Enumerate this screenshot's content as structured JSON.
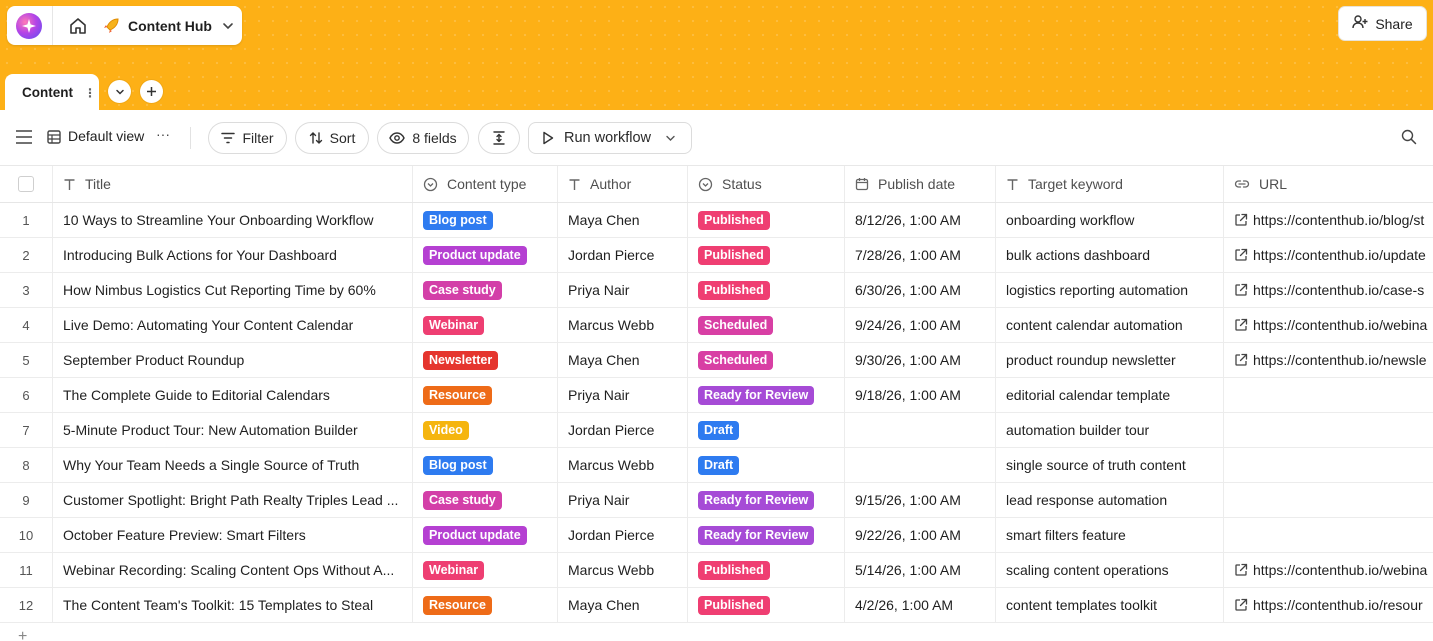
{
  "header": {
    "hub_title": "Content Hub",
    "share_label": "Share"
  },
  "tabs": [
    {
      "label": "Content"
    }
  ],
  "toolbar": {
    "view_label": "Default view",
    "more": "···",
    "filter_label": "Filter",
    "sort_label": "Sort",
    "fields_label": "8 fields",
    "workflow_label": "Run workflow"
  },
  "columns": {
    "title": "Title",
    "content_type": "Content type",
    "author": "Author",
    "status": "Status",
    "publish_date": "Publish date",
    "target_keyword": "Target keyword",
    "url": "URL"
  },
  "colors": {
    "header_band": "#fdb016",
    "type": {
      "Blog post": "#2e7bf0",
      "Product update": "#b540d2",
      "Case study": "#d33fa8",
      "Webinar": "#ee3e72",
      "Newsletter": "#e5352e",
      "Resource": "#ee6b18",
      "Video": "#f5b50f"
    },
    "status": {
      "Published": "#ef3e72",
      "Scheduled": "#d83fa4",
      "Ready for Review": "#a64bd6",
      "Draft": "#2e7bf0"
    }
  },
  "rows": [
    {
      "num": "1",
      "title": "10 Ways to Streamline Your Onboarding Workflow",
      "type": "Blog post",
      "author": "Maya Chen",
      "status": "Published",
      "date": "8/12/26, 1:00 AM",
      "keyword": "onboarding workflow",
      "url": "https://contenthub.io/blog/st"
    },
    {
      "num": "2",
      "title": "Introducing Bulk Actions for Your Dashboard",
      "type": "Product update",
      "author": "Jordan Pierce",
      "status": "Published",
      "date": "7/28/26, 1:00 AM",
      "keyword": "bulk actions dashboard",
      "url": "https://contenthub.io/update"
    },
    {
      "num": "3",
      "title": "How Nimbus Logistics Cut Reporting Time by 60%",
      "type": "Case study",
      "author": "Priya Nair",
      "status": "Published",
      "date": "6/30/26, 1:00 AM",
      "keyword": "logistics reporting automation",
      "url": "https://contenthub.io/case-s"
    },
    {
      "num": "4",
      "title": "Live Demo: Automating Your Content Calendar",
      "type": "Webinar",
      "author": "Marcus Webb",
      "status": "Scheduled",
      "date": "9/24/26, 1:00 AM",
      "keyword": "content calendar automation",
      "url": "https://contenthub.io/webina"
    },
    {
      "num": "5",
      "title": "September Product Roundup",
      "type": "Newsletter",
      "author": "Maya Chen",
      "status": "Scheduled",
      "date": "9/30/26, 1:00 AM",
      "keyword": "product roundup newsletter",
      "url": "https://contenthub.io/newsle"
    },
    {
      "num": "6",
      "title": "The Complete Guide to Editorial Calendars",
      "type": "Resource",
      "author": "Priya Nair",
      "status": "Ready for Review",
      "date": "9/18/26, 1:00 AM",
      "keyword": "editorial calendar template",
      "url": ""
    },
    {
      "num": "7",
      "title": "5-Minute Product Tour: New Automation Builder",
      "type": "Video",
      "author": "Jordan Pierce",
      "status": "Draft",
      "date": "",
      "keyword": "automation builder tour",
      "url": ""
    },
    {
      "num": "8",
      "title": "Why Your Team Needs a Single Source of Truth",
      "type": "Blog post",
      "author": "Marcus Webb",
      "status": "Draft",
      "date": "",
      "keyword": "single source of truth content",
      "url": ""
    },
    {
      "num": "9",
      "title": "Customer Spotlight: Bright Path Realty Triples Lead ...",
      "type": "Case study",
      "author": "Priya Nair",
      "status": "Ready for Review",
      "date": "9/15/26, 1:00 AM",
      "keyword": "lead response automation",
      "url": ""
    },
    {
      "num": "10",
      "title": "October Feature Preview: Smart Filters",
      "type": "Product update",
      "author": "Jordan Pierce",
      "status": "Ready for Review",
      "date": "9/22/26, 1:00 AM",
      "keyword": "smart filters feature",
      "url": ""
    },
    {
      "num": "11",
      "title": "Webinar Recording: Scaling Content Ops Without A...",
      "type": "Webinar",
      "author": "Marcus Webb",
      "status": "Published",
      "date": "5/14/26, 1:00 AM",
      "keyword": "scaling content operations",
      "url": "https://contenthub.io/webina"
    },
    {
      "num": "12",
      "title": "The Content Team's Toolkit: 15 Templates to Steal",
      "type": "Resource",
      "author": "Maya Chen",
      "status": "Published",
      "date": "4/2/26, 1:00 AM",
      "keyword": "content templates toolkit",
      "url": "https://contenthub.io/resour"
    }
  ]
}
